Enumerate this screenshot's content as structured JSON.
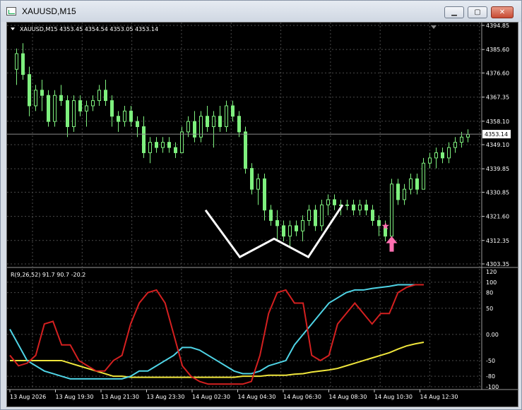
{
  "window": {
    "title": "XAUUSD,M15",
    "minimize_label": "▁",
    "maximize_label": "▢",
    "close_label": "✕",
    "icon": "chart-window-icon"
  },
  "colors": {
    "background": "#000000",
    "grid": "#4a4a4a",
    "bull_candle": "#7ef07e",
    "bear_candle": "#7ef07e",
    "line_red": "#d42020",
    "line_cyan": "#4fd4e6",
    "line_yellow": "#f0e63c",
    "overlay_white": "#ffffff",
    "signal_pink": "#ff6fb0"
  },
  "price_panel": {
    "info": "XAUUSD,M15  4353.45 4354.54 4353.05 4353.14",
    "current_price": "4353.14",
    "axis_labels": [
      "4394.85",
      "4385.60",
      "4376.60",
      "4367.35",
      "4358.10",
      "4349.10",
      "4339.85",
      "4330.85",
      "4321.60",
      "4312.35",
      "4303.35"
    ],
    "axis_values": [
      4394.85,
      4385.6,
      4376.6,
      4367.35,
      4358.1,
      4349.1,
      4339.85,
      4330.85,
      4321.6,
      4312.35,
      4303.35
    ],
    "ylim": [
      4303.35,
      4394.85
    ],
    "candles": [
      [
        4378,
        4386,
        4372,
        4384
      ],
      [
        4384,
        4388,
        4374,
        4376
      ],
      [
        4376,
        4379,
        4360,
        4364
      ],
      [
        4364,
        4372,
        4362,
        4370
      ],
      [
        4370,
        4374,
        4362,
        4368
      ],
      [
        4368,
        4370,
        4356,
        4358
      ],
      [
        4358,
        4370,
        4356,
        4368
      ],
      [
        4368,
        4372,
        4364,
        4366
      ],
      [
        4366,
        4368,
        4352,
        4356
      ],
      [
        4356,
        4368,
        4354,
        4366
      ],
      [
        4366,
        4368,
        4360,
        4362
      ],
      [
        4362,
        4366,
        4356,
        4364
      ],
      [
        4364,
        4368,
        4362,
        4366
      ],
      [
        4366,
        4372,
        4364,
        4370
      ],
      [
        4370,
        4374,
        4364,
        4366
      ],
      [
        4366,
        4368,
        4356,
        4360
      ],
      [
        4360,
        4362,
        4354,
        4358
      ],
      [
        4358,
        4364,
        4356,
        4362
      ],
      [
        4362,
        4364,
        4356,
        4358
      ],
      [
        4358,
        4360,
        4352,
        4356
      ],
      [
        4356,
        4360,
        4344,
        4346
      ],
      [
        4346,
        4352,
        4342,
        4350
      ],
      [
        4350,
        4352,
        4346,
        4348
      ],
      [
        4348,
        4352,
        4346,
        4350
      ],
      [
        4350,
        4352,
        4346,
        4348
      ],
      [
        4348,
        4350,
        4344,
        4346
      ],
      [
        4346,
        4356,
        4346,
        4354
      ],
      [
        4354,
        4360,
        4352,
        4358
      ],
      [
        4358,
        4362,
        4350,
        4352
      ],
      [
        4352,
        4362,
        4350,
        4360
      ],
      [
        4360,
        4364,
        4354,
        4356
      ],
      [
        4356,
        4362,
        4348,
        4360
      ],
      [
        4360,
        4364,
        4354,
        4356
      ],
      [
        4356,
        4366,
        4354,
        4364
      ],
      [
        4364,
        4366,
        4358,
        4360
      ],
      [
        4360,
        4362,
        4352,
        4354
      ],
      [
        4354,
        4356,
        4338,
        4340
      ],
      [
        4340,
        4342,
        4330,
        4332
      ],
      [
        4332,
        4338,
        4326,
        4336
      ],
      [
        4336,
        4338,
        4320,
        4324
      ],
      [
        4324,
        4326,
        4318,
        4320
      ],
      [
        4320,
        4324,
        4312,
        4318
      ],
      [
        4318,
        4320,
        4312,
        4314
      ],
      [
        4314,
        4320,
        4310,
        4318
      ],
      [
        4318,
        4320,
        4314,
        4316
      ],
      [
        4316,
        4322,
        4312,
        4320
      ],
      [
        4320,
        4326,
        4318,
        4324
      ],
      [
        4324,
        4326,
        4316,
        4318
      ],
      [
        4318,
        4328,
        4316,
        4326
      ],
      [
        4326,
        4330,
        4322,
        4328
      ],
      [
        4328,
        4330,
        4324,
        4326
      ],
      [
        4326,
        4328,
        4322,
        4326
      ],
      [
        4326,
        4328,
        4324,
        4326
      ],
      [
        4326,
        4328,
        4322,
        4324
      ],
      [
        4324,
        4328,
        4322,
        4326
      ],
      [
        4326,
        4328,
        4322,
        4324
      ],
      [
        4324,
        4326,
        4318,
        4320
      ],
      [
        4320,
        4322,
        4314,
        4318
      ],
      [
        4318,
        4320,
        4312,
        4314
      ],
      [
        4314,
        4336,
        4314,
        4334
      ],
      [
        4334,
        4336,
        4326,
        4328
      ],
      [
        4328,
        4334,
        4326,
        4332
      ],
      [
        4332,
        4338,
        4330,
        4336
      ],
      [
        4336,
        4338,
        4330,
        4332
      ],
      [
        4332,
        4344,
        4332,
        4342
      ],
      [
        4342,
        4346,
        4340,
        4344
      ],
      [
        4344,
        4348,
        4340,
        4346
      ],
      [
        4346,
        4348,
        4342,
        4344
      ],
      [
        4344,
        4350,
        4342,
        4348
      ],
      [
        4348,
        4352,
        4346,
        4350
      ],
      [
        4350,
        4354,
        4348,
        4352
      ],
      [
        4352,
        4355,
        4350,
        4353
      ]
    ],
    "white_overlay_points": [
      [
        4324,
        0
      ],
      [
        4306,
        1
      ],
      [
        4313,
        2
      ],
      [
        4306,
        3
      ],
      [
        4326,
        4
      ]
    ],
    "star_index": 58,
    "arrow_index": 59
  },
  "indicator_panel": {
    "info": "R(9,26,52) 91.7 90.7 -20.2",
    "axis_labels": [
      "120",
      "100",
      "80",
      "50",
      "0.00",
      "-50",
      "-80",
      "-100"
    ],
    "axis_values": [
      120,
      100,
      80,
      50,
      0,
      -50,
      -80,
      -100
    ],
    "ylim": [
      -100,
      120
    ],
    "red": [
      -40,
      -60,
      -55,
      -40,
      20,
      25,
      -20,
      -20,
      -50,
      -60,
      -70,
      -70,
      -50,
      -40,
      20,
      60,
      80,
      85,
      60,
      0,
      -60,
      -80,
      -90,
      -95,
      -95,
      -95,
      -95,
      -95,
      -90,
      -40,
      40,
      80,
      85,
      60,
      60,
      -40,
      -50,
      -40,
      20,
      40,
      60,
      40,
      20,
      40,
      40,
      80,
      90,
      95,
      95
    ],
    "cyan": [
      10,
      -20,
      -50,
      -60,
      -70,
      -75,
      -80,
      -85,
      -85,
      -85,
      -85,
      -85,
      -85,
      -85,
      -80,
      -70,
      -70,
      -60,
      -50,
      -40,
      -25,
      -25,
      -30,
      -40,
      -50,
      -60,
      -70,
      -75,
      -75,
      -70,
      -60,
      -55,
      -50,
      -20,
      0,
      20,
      40,
      60,
      70,
      80,
      85,
      85,
      88,
      90,
      92,
      95,
      95,
      95,
      95
    ],
    "yellow": [
      -50,
      -50,
      -50,
      -50,
      -50,
      -50,
      -50,
      -55,
      -60,
      -65,
      -70,
      -75,
      -80,
      -80,
      -82,
      -82,
      -82,
      -82,
      -82,
      -82,
      -82,
      -82,
      -82,
      -82,
      -82,
      -82,
      -82,
      -80,
      -80,
      -80,
      -78,
      -78,
      -78,
      -76,
      -75,
      -72,
      -70,
      -68,
      -65,
      -60,
      -55,
      -50,
      -45,
      -40,
      -35,
      -28,
      -22,
      -18,
      -15
    ]
  },
  "time_axis": {
    "labels": [
      "13 Aug 2026",
      "13 Aug 19:30",
      "13 Aug 21:30",
      "13 Aug 23:30",
      "14 Aug 02:30",
      "14 Aug 04:30",
      "14 Aug 06:30",
      "14 Aug 08:30",
      "14 Aug 10:30",
      "14 Aug 12:30"
    ]
  }
}
